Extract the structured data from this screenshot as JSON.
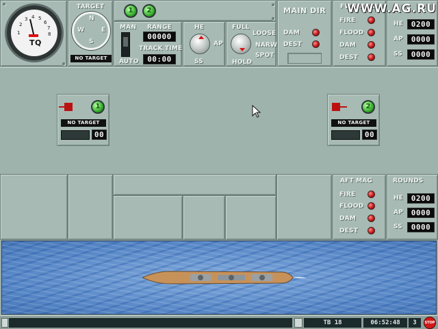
{
  "gauge": {
    "label": "TQ",
    "scale": [
      "1",
      "2",
      "3",
      "4",
      "5",
      "6",
      "7",
      "8"
    ]
  },
  "compass": {
    "label": "TARGET",
    "n": "N",
    "w": "W",
    "e": "E",
    "s": "S",
    "target": "NO TARGET"
  },
  "turret_select": {
    "buttons": [
      "1",
      "2"
    ]
  },
  "fire_mode": {
    "man": "MAN",
    "auto": "AUTO",
    "range_label": "RANGE",
    "range_value": "00000",
    "track_label": "TRACK TIME",
    "track_value": "00:00"
  },
  "ammo_knob": {
    "he": "HE",
    "ap": "AP",
    "ss": "SS"
  },
  "salvo_knob": {
    "full": "FULL",
    "loose": "LOOSE",
    "narrow": "NARW",
    "spot": "SPOT",
    "hold": "HOLD"
  },
  "main_dir": {
    "title": "MAIN DIR",
    "dam": "DAM",
    "dest": "DEST"
  },
  "fwd_mag": {
    "title": "FWD MAG",
    "items": [
      "FIRE",
      "FLOOD",
      "DAM",
      "DEST"
    ]
  },
  "fwd_rounds": {
    "he": "HE",
    "he_val": "0200",
    "ap": "AP",
    "ap_val": "0000",
    "ss": "SS",
    "ss_val": "0000"
  },
  "turret_left": {
    "number": "1",
    "target": "NO TARGET",
    "count": "00"
  },
  "turret_right": {
    "number": "2",
    "target": "NO TARGET",
    "count": "00"
  },
  "aft_mag": {
    "title": "AFT MAG",
    "items": [
      "FIRE",
      "FLOOD",
      "DAM",
      "DEST"
    ]
  },
  "aft_rounds": {
    "title": "ROUNDS",
    "he": "HE",
    "he_val": "0200",
    "ap": "AP",
    "ap_val": "0000",
    "ss": "SS",
    "ss_val": "0000"
  },
  "status": {
    "unit": "TB 18",
    "time": "06:52:48",
    "speed": "3",
    "stop": "STOP"
  },
  "watermark": "WWW.AG.RU",
  "colors": {
    "lamp_red": "#c81616",
    "button_green": "#36b02c",
    "panel": "#a7bab4",
    "sea": "#5686c6"
  }
}
